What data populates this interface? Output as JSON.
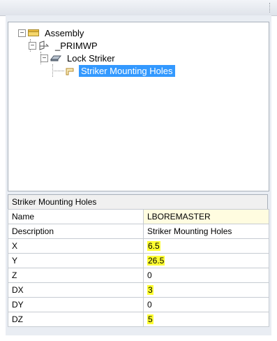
{
  "tree": {
    "nodes": [
      {
        "label": "Assembly",
        "icon": "assembly-icon",
        "expander": "−"
      },
      {
        "label": "_PRIMWP",
        "icon": "workplane-icon",
        "expander": "−"
      },
      {
        "label": "Lock Striker",
        "icon": "part-icon",
        "expander": "−"
      },
      {
        "label": "Striker Mounting Holes",
        "icon": "feature-icon",
        "selected": true
      }
    ]
  },
  "properties": {
    "header": "Striker Mounting Holes",
    "rows": [
      {
        "key": "Name",
        "value": "LBOREMASTER",
        "highlight": false
      },
      {
        "key": "Description",
        "value": "Striker Mounting Holes",
        "highlight": false
      },
      {
        "key": "X",
        "value": "6.5",
        "highlight": true
      },
      {
        "key": "Y",
        "value": "26.5",
        "highlight": true
      },
      {
        "key": "Z",
        "value": "0",
        "highlight": false
      },
      {
        "key": "DX",
        "value": "3",
        "highlight": true
      },
      {
        "key": "DY",
        "value": "0",
        "highlight": false
      },
      {
        "key": "DZ",
        "value": "5",
        "highlight": true
      }
    ]
  },
  "colors": {
    "selection": "#3399ff",
    "highlight": "#ffff33",
    "name_row": "#fffce0"
  }
}
